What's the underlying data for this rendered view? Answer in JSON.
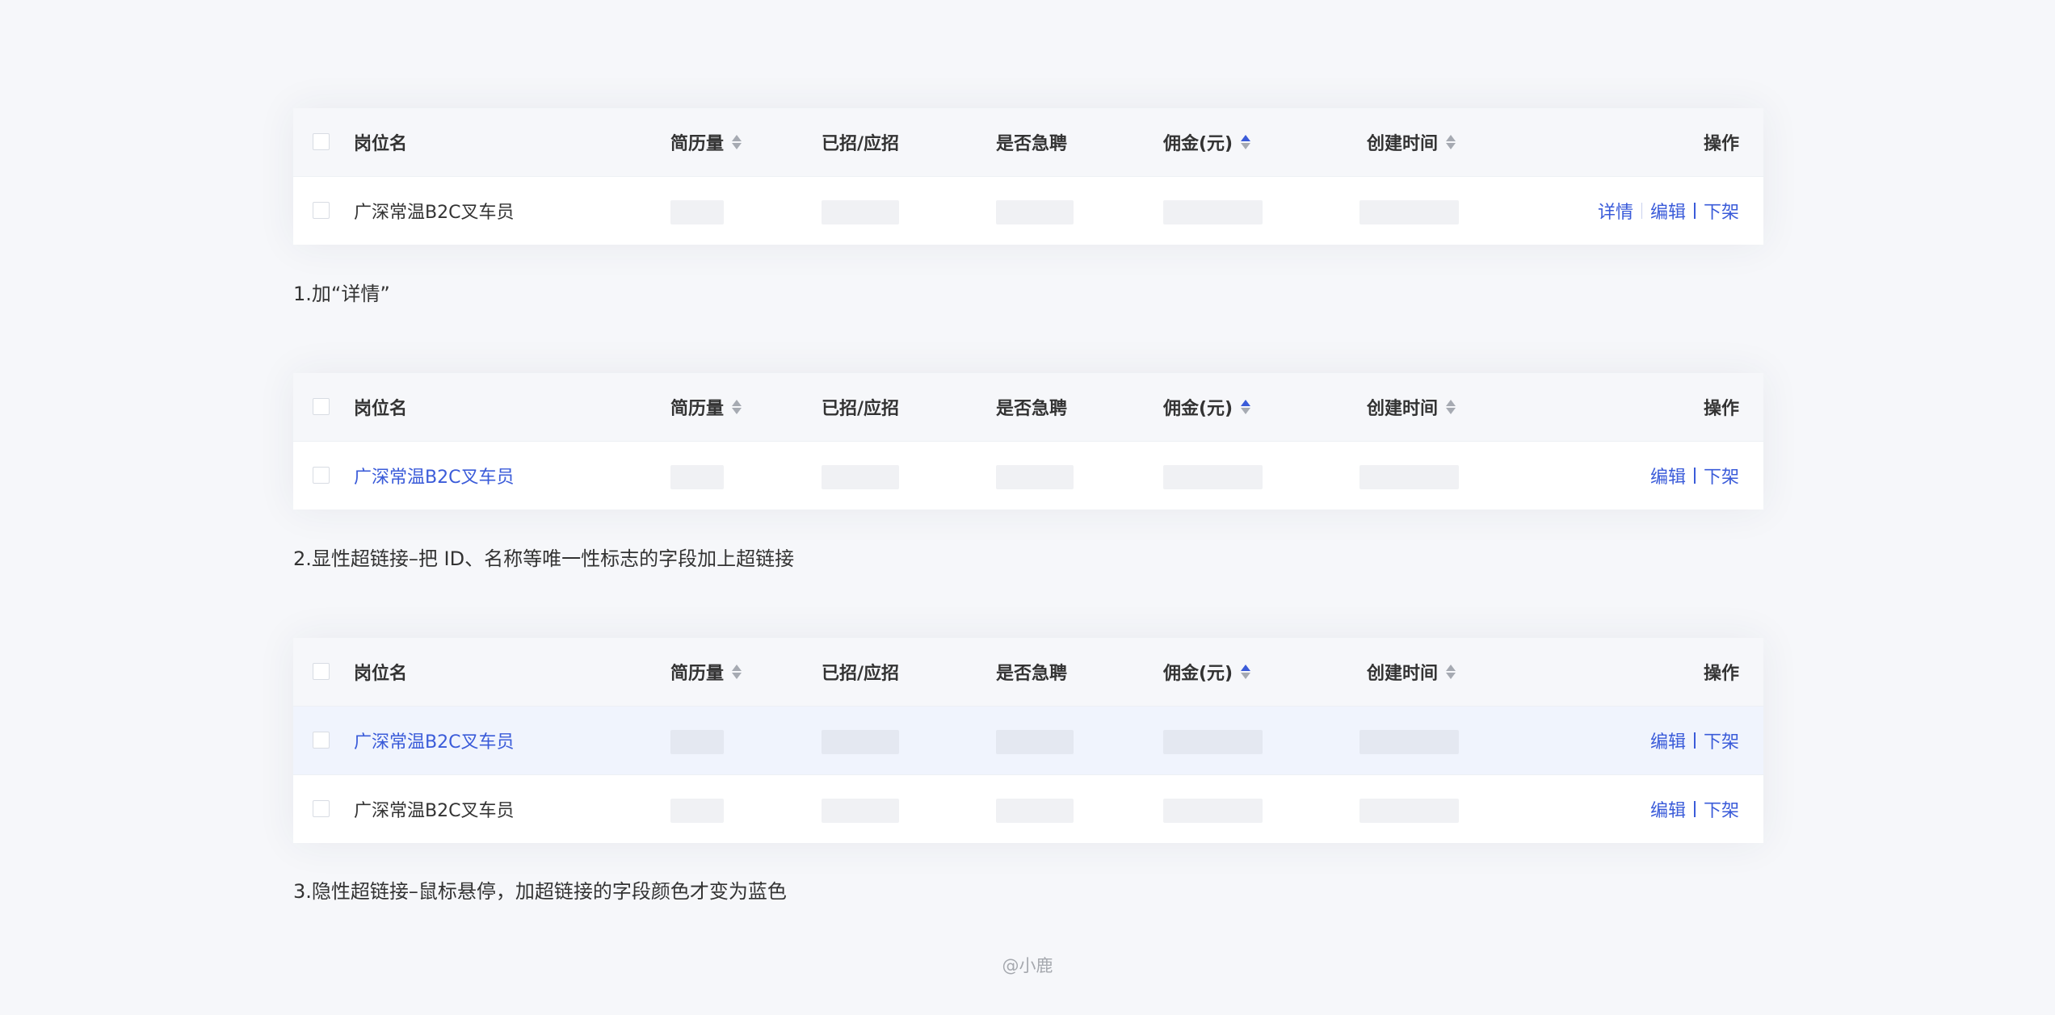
{
  "columns": {
    "name": "岗位名",
    "resume": "简历量",
    "hired": "已招/应招",
    "urgent": "是否急聘",
    "fee": "佣金(元)",
    "created": "创建时间",
    "ops": "操作"
  },
  "job_title": "广深常温B2C叉车员",
  "actions": {
    "detail": "详情",
    "edit": "编辑",
    "offline": "下架"
  },
  "captions": [
    "1.加“详情”",
    "2.显性超链接–把 ID、名称等唯一性标志的字段加上超链接",
    "3.隐性超链接–鼠标悬停，加超链接的字段颜色才变为蓝色"
  ],
  "footer": "@小鹿",
  "colors": {
    "link": "#3a5bd9",
    "header_bg": "#f6f7fa",
    "hover_bg": "#f0f4fd",
    "page_bg": "#f6f7fa"
  }
}
